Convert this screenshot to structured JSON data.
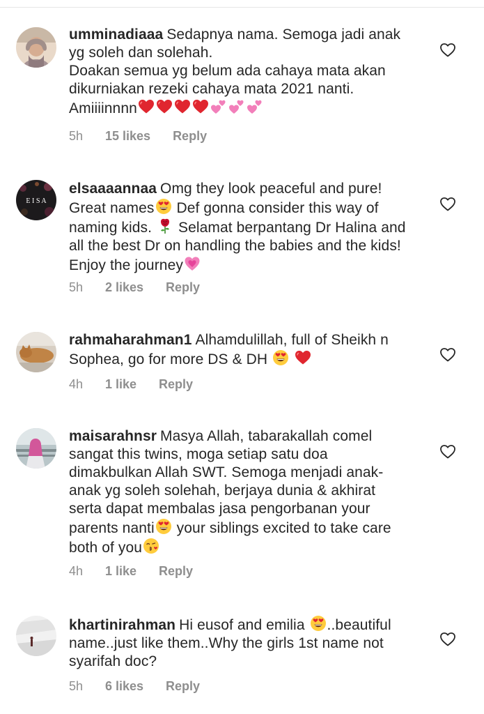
{
  "comments": [
    {
      "username": "umminadiaaa",
      "paragraphs": [
        "Sedapnya nama. Semoga jadi anak yg soleh dan solehah.",
        "Doakan semua yg belum ada cahaya mata akan dikurniakan rezeki cahaya mata 2021 nanti. Amiiiinnnn"
      ],
      "emojis": [
        "red-heart-emoji",
        "red-heart-emoji",
        "red-heart-emoji",
        "red-heart-emoji",
        "two-hearts-emoji",
        "two-hearts-emoji",
        "two-hearts-emoji"
      ],
      "time": "5h",
      "likes": "15 likes",
      "reply": "Reply",
      "like_icon": "heart-outline-icon"
    },
    {
      "username": "elsaaaannaa",
      "text_parts": [
        "Omg they look peaceful and pure! Great names",
        "Def gonna consider this way of naming kids.",
        "Selamat berpantang Dr Halina and all the best Dr on handling the babies and the kids! Enjoy the journey"
      ],
      "emojis": [
        "heart-eyes-emoji",
        "rose-emoji",
        "growing-heart-emoji"
      ],
      "avatar_text": "E I S A",
      "time": "5h",
      "likes": "2 likes",
      "reply": "Reply",
      "like_icon": "heart-outline-icon"
    },
    {
      "username": "rahmaharahman1",
      "text_parts": [
        "Alhamdulillah, full of Sheikh n Sophea, go for more DS & DH"
      ],
      "emojis": [
        "heart-eyes-emoji",
        "red-heart-emoji"
      ],
      "time": "4h",
      "likes": "1 like",
      "reply": "Reply",
      "like_icon": "heart-outline-icon"
    },
    {
      "username": "maisarahnsr",
      "text_parts": [
        "Masya Allah, tabarakallah comel sangat this twins, moga setiap satu doa dimakbulkan Allah SWT. Semoga menjadi anak-anak yg soleh solehah, berjaya dunia & akhirat serta dapat membalas jasa pengorbanan your parents nanti",
        "your siblings excited to take care both of you"
      ],
      "emojis": [
        "heart-eyes-emoji",
        "kissing-face-emoji"
      ],
      "time": "4h",
      "likes": "1 like",
      "reply": "Reply",
      "like_icon": "heart-outline-icon"
    },
    {
      "username": "khartinirahman",
      "text_parts": [
        "Hi eusof and emilia",
        "..beautiful name..just like them..Why the girls 1st name not syarifah doc?"
      ],
      "emojis": [
        "heart-eyes-emoji"
      ],
      "time": "5h",
      "likes": "6 likes",
      "reply": "Reply",
      "like_icon": "heart-outline-icon"
    }
  ],
  "colors": {
    "text": "#262626",
    "meta": "#8e8e8e",
    "heart_red": "#e0262f",
    "heart_pink": "#f27fba",
    "emoji_yellow": "#ffcc3d"
  }
}
